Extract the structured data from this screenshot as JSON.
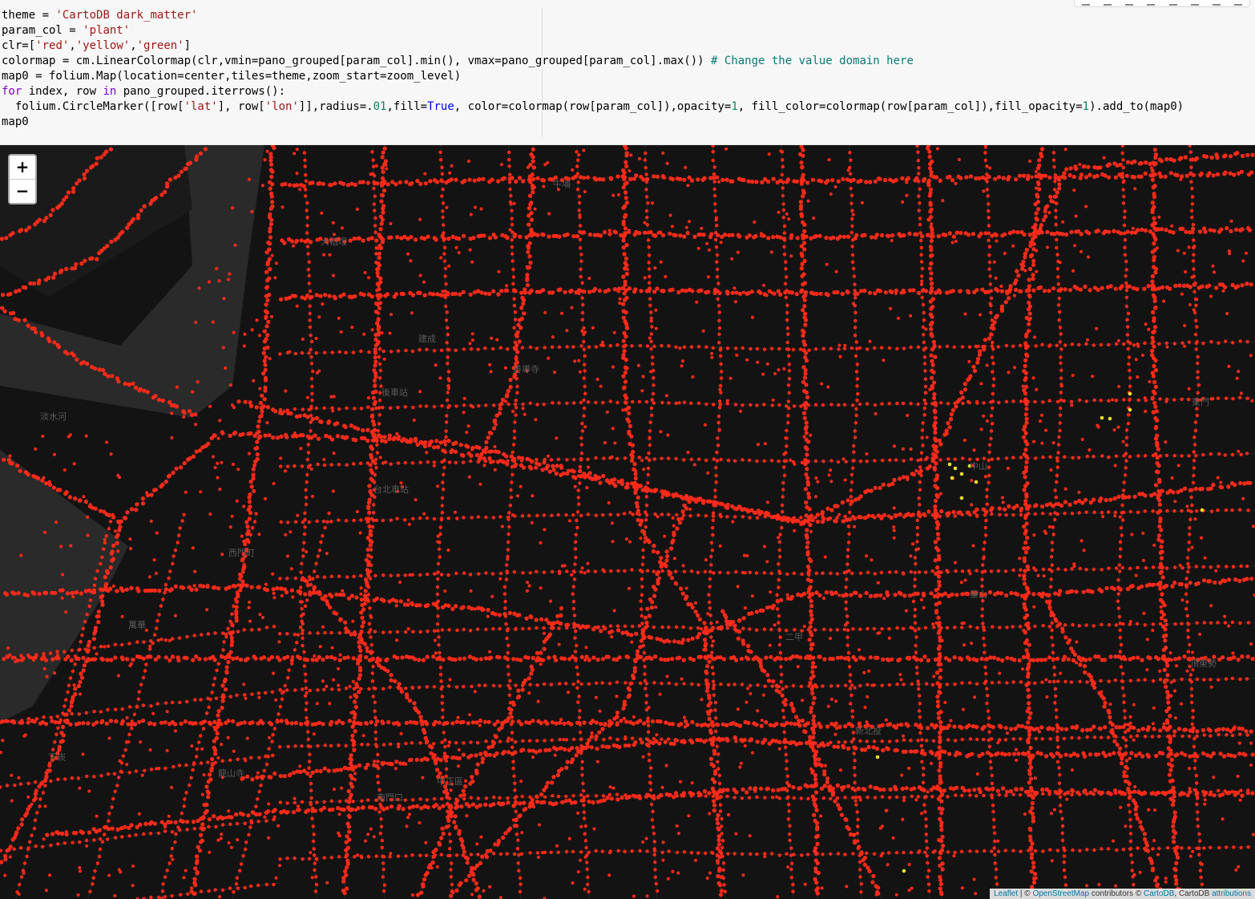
{
  "notebook": {
    "code_lines": [
      "theme = 'CartoDB dark_matter'",
      "param_col = 'plant'",
      "clr=['red','yellow','green']",
      "colormap = cm.LinearColormap(clr,vmin=pano_grouped[param_col].min(), vmax=pano_grouped[param_col].max()) # Change the value domain here",
      "map0 = folium.Map(location=center,tiles=theme,zoom_start=zoom_level)",
      "for index, row in pano_grouped.iterrows():",
      "  folium.CircleMarker([row['lat'], row['lon']],radius=.01,fill=True, color=colormap(row[param_col]),opacity=1, fill_color=colormap(row[param_col]),fill_opacity=1).add_to(map0)",
      "map0"
    ]
  },
  "map": {
    "tiles": "CartoDB dark_matter",
    "background_color": "#131313",
    "river_color": "#2a2a2a",
    "marker_colors": {
      "low": "#ff2a1a",
      "high": "#e8e030"
    },
    "zoom_in_label": "+",
    "zoom_out_label": "−",
    "attribution": {
      "leaflet": "Leaflet",
      "sep1": " | © ",
      "osm": "OpenStreetMap",
      "contrib": " contributors © ",
      "cartodb": "CartoDB",
      "sep2": ", CartoDB ",
      "attributions": "attributions"
    },
    "place_labels": [
      "大稻埕",
      "建成",
      "後車站",
      "台北車站",
      "西門町",
      "萬華",
      "中正區",
      "南門口",
      "善導寺",
      "二甲",
      "新北投",
      "牛埔",
      "中山",
      "華山",
      "東門",
      "頂東勢",
      "下崁",
      "龍山寺",
      "淡水河"
    ]
  }
}
